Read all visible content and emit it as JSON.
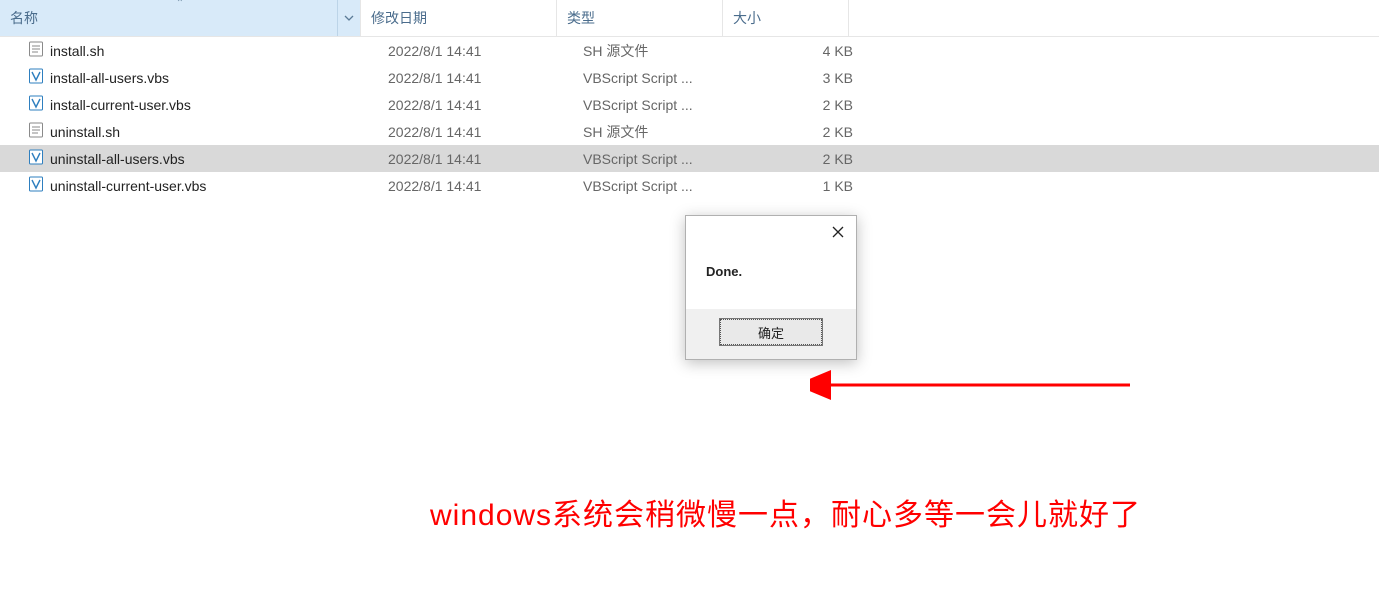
{
  "columns": {
    "name": "名称",
    "date": "修改日期",
    "type": "类型",
    "size": "大小"
  },
  "files": [
    {
      "name": "install.sh",
      "date": "2022/8/1 14:41",
      "type": "SH 源文件",
      "size": "4 KB",
      "icon": "sh",
      "selected": false
    },
    {
      "name": "install-all-users.vbs",
      "date": "2022/8/1 14:41",
      "type": "VBScript Script ...",
      "size": "3 KB",
      "icon": "vbs",
      "selected": false
    },
    {
      "name": "install-current-user.vbs",
      "date": "2022/8/1 14:41",
      "type": "VBScript Script ...",
      "size": "2 KB",
      "icon": "vbs",
      "selected": false
    },
    {
      "name": "uninstall.sh",
      "date": "2022/8/1 14:41",
      "type": "SH 源文件",
      "size": "2 KB",
      "icon": "sh",
      "selected": false
    },
    {
      "name": "uninstall-all-users.vbs",
      "date": "2022/8/1 14:41",
      "type": "VBScript Script ...",
      "size": "2 KB",
      "icon": "vbs",
      "selected": true
    },
    {
      "name": "uninstall-current-user.vbs",
      "date": "2022/8/1 14:41",
      "type": "VBScript Script ...",
      "size": "1 KB",
      "icon": "vbs",
      "selected": false
    }
  ],
  "dialog": {
    "message": "Done.",
    "ok_label": "确定"
  },
  "annotation": "windows系统会稍微慢一点，耐心多等一会儿就好了"
}
